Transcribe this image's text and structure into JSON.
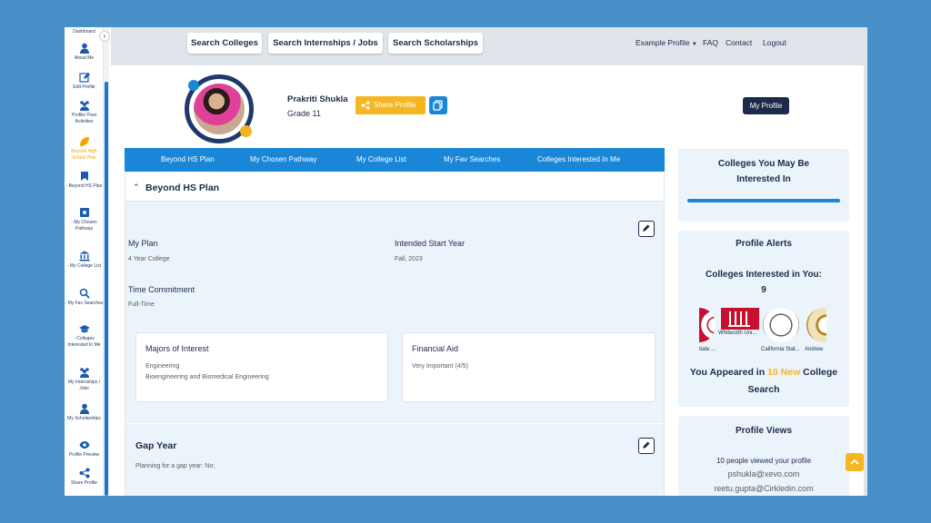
{
  "sidebar": {
    "items": [
      {
        "label": "Dashboard",
        "icon": "dashboard-icon"
      },
      {
        "label": "About Me",
        "icon": "person-icon"
      },
      {
        "label": "Edit Profile",
        "icon": "edit-icon"
      },
      {
        "label": "Profile/ Past Activities",
        "icon": "group-icon"
      },
      {
        "label": "Beyond High School Plan",
        "icon": "leaf-icon"
      },
      {
        "label": "- Beyond HS Plan",
        "icon": "bookmark-icon"
      },
      {
        "label": "- My Chosen Pathway",
        "icon": "pathway-icon"
      },
      {
        "label": "- My College List",
        "icon": "bank-icon"
      },
      {
        "label": "- My Fav Searches",
        "icon": "search-icon"
      },
      {
        "label": "- Colleges Interested In Me",
        "icon": "graduation-cap-icon"
      },
      {
        "label": "My Internships / Jobs",
        "icon": "group-icon"
      },
      {
        "label": "My Scholarships",
        "icon": "person-icon"
      },
      {
        "label": "Profile Preview",
        "icon": "eye-icon"
      },
      {
        "label": "Share Profile",
        "icon": "share-icon"
      }
    ],
    "toggle": "›"
  },
  "topnav": {
    "buttons": [
      "Search Colleges",
      "Search Internships / Jobs",
      "Search Scholarships"
    ],
    "example_profile": "Example Profile",
    "links": [
      "FAQ",
      "Contact",
      "Logout"
    ]
  },
  "profile": {
    "name": "Prakriti Shukla",
    "grade": "Grade 11",
    "share_label": "Share Profile",
    "my_profile_label": "My Profile"
  },
  "tabs": [
    "Beyond HS Plan",
    "My Chosen Pathway",
    "My College List",
    "My Fav Searches",
    "Colleges Interested In Me"
  ],
  "plan": {
    "section_title": "Beyond HS Plan",
    "my_plan_label": "My Plan",
    "my_plan_value": "4 Year College",
    "start_label": "Intended Start Year",
    "start_value": "Fall, 2023",
    "commitment_label": "Time Commitment",
    "commitment_value": "Full-Time",
    "majors_title": "Majors of Interest",
    "majors_1": "Engineering",
    "majors_2": "Bioengineering and Biomedical Engineering",
    "aid_title": "Financial Aid",
    "aid_value": "Very Important (4/5)",
    "gap_title": "Gap Year",
    "gap_value": "Planning for a gap year: No;"
  },
  "right": {
    "may_be_interested": "Colleges You May Be Interested In",
    "alerts_title": "Profile Alerts",
    "interested_title": "Colleges Interested in You: 9",
    "logos": [
      "itate ...",
      "Whitworth Uni...",
      "California Stat...",
      "Andrew"
    ],
    "appeared_pre": "You Appeared in",
    "appeared_hl": "10 New",
    "appeared_post": "College Search",
    "views_title": "Profile Views",
    "views_count": "10 people viewed your profile",
    "viewers": [
      "pshukla@xevo.com",
      "reetu.gupta@Cirkledin.com"
    ]
  },
  "colors": {
    "primary_blue": "#1a86d8",
    "navy": "#1d2b4a",
    "accent_yellow": "#f6b622",
    "panel_bg": "#eaf4fa",
    "outer_bg": "#4a90c8"
  }
}
